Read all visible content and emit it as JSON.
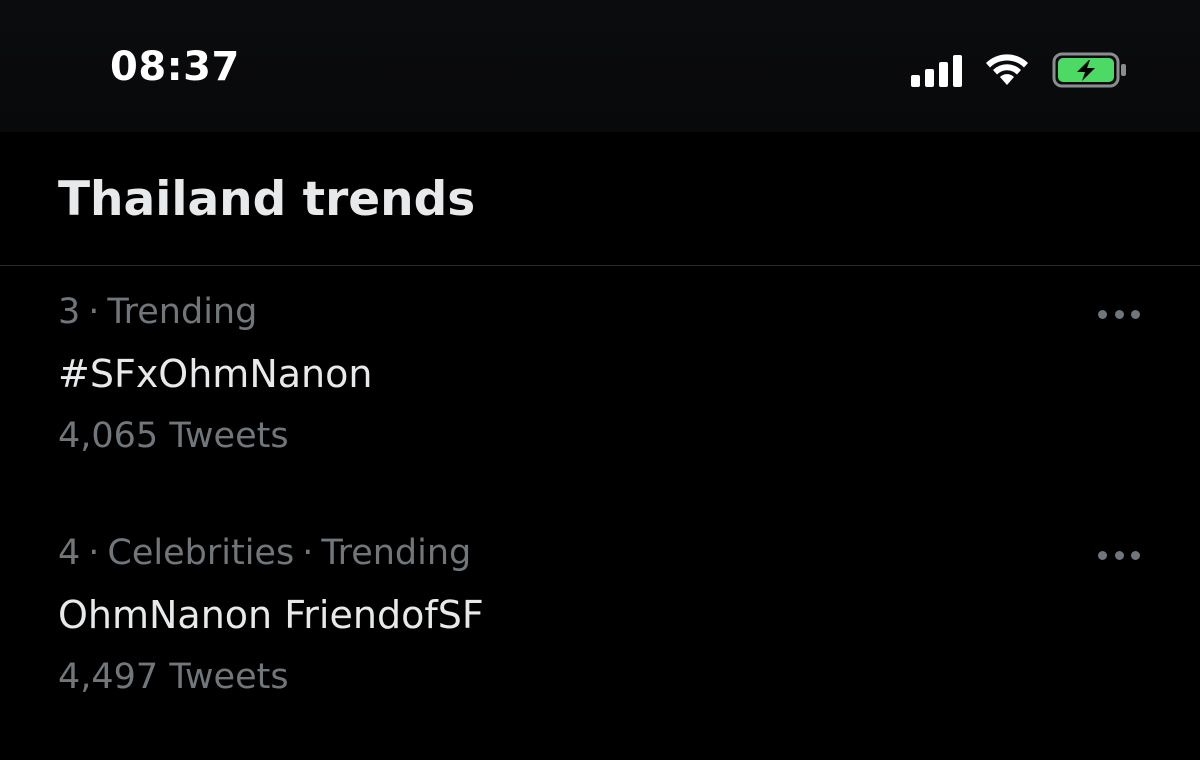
{
  "status_bar": {
    "time": "08:37",
    "icons": [
      "signal-icon",
      "wifi-icon",
      "battery-charging-icon"
    ],
    "battery_color": "#4cd964"
  },
  "header": {
    "title": "Thailand trends"
  },
  "trends": [
    {
      "rank": "3",
      "separator": "·",
      "context": "Trending",
      "name": "#SFxOhmNanon",
      "count": "4,065 Tweets"
    },
    {
      "rank": "4",
      "separator": "·",
      "category": "Celebrities",
      "separator2": "·",
      "context": "Trending",
      "name": "OhmNanon FriendofSF",
      "count": "4,497 Tweets"
    }
  ],
  "colors": {
    "background": "#000000",
    "primary_text": "#e7e9ea",
    "secondary_text": "#71767b",
    "divider": "#2a2d30"
  }
}
